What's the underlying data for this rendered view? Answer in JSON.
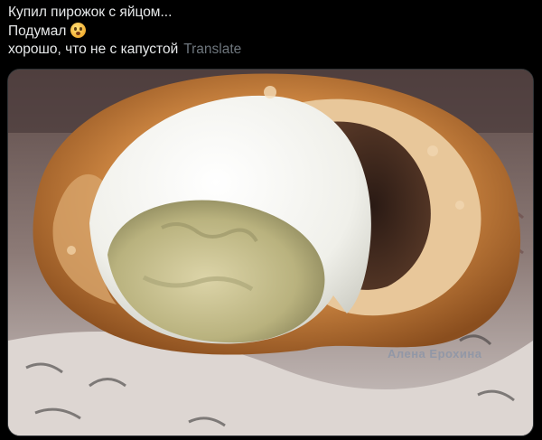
{
  "post": {
    "lines": [
      "Купил пирожок с яйцом...",
      "Подумал",
      "хорошо, что не с капустой"
    ],
    "emoji_icon": "flushed-face-icon",
    "translate_label": "Translate"
  },
  "photo": {
    "watermark": "Алена Ерохина",
    "accent_colors": {
      "crust": "#c8823f",
      "egg_white": "#f2f2ee",
      "yolk": "#cbc48f",
      "tablecloth": "#d9d3cf"
    }
  }
}
